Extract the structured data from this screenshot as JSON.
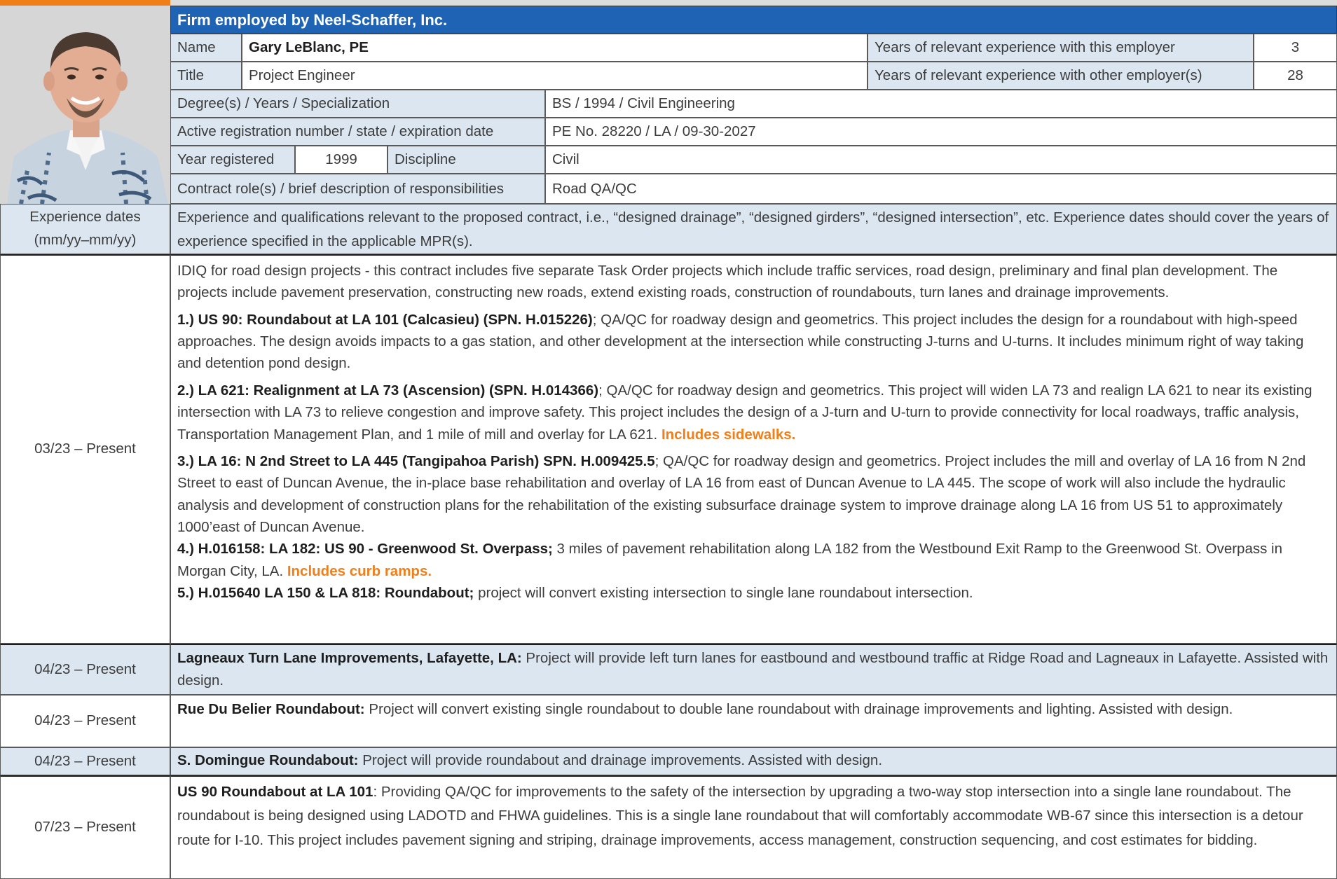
{
  "header": {
    "firm": "Firm employed by Neel-Schaffer, Inc."
  },
  "photo": {
    "alt": "Portrait photo"
  },
  "info": {
    "name_label": "Name",
    "name_value": "Gary LeBlanc, PE",
    "years_employer_label": "Years of relevant experience with this employer",
    "years_employer_value": "3",
    "title_label": "Title",
    "title_value": "Project Engineer",
    "years_other_label": "Years of relevant experience with other employer(s)",
    "years_other_value": "28",
    "degree_label": "Degree(s) / Years / Specialization",
    "degree_value": "BS / 1994 / Civil Engineering",
    "registration_label": "Active registration number / state / expiration date",
    "registration_value": "PE No. 28220 / LA / 09-30-2027",
    "year_registered_label": "Year registered",
    "year_registered_value": "1999",
    "discipline_label": "Discipline",
    "discipline_value": "Civil",
    "role_label": "Contract role(s) / brief description of responsibilities",
    "role_value": "Road QA/QC"
  },
  "experience_header": {
    "dates_label": "Experience dates (mm/yy–mm/yy)",
    "description": "Experience and qualifications relevant to the proposed contract, i.e., “designed drainage”, “designed girders”, “designed intersection”, etc. Experience dates should cover the years of experience specified in the applicable MPR(s)."
  },
  "entries": [
    {
      "dates": "03/23 – Present",
      "intro": "IDIQ for road design projects - this contract includes five separate Task Order projects which include traffic services, road design, preliminary and final plan development. The projects include pavement preservation, constructing new roads, extend existing roads, construction of roundabouts, turn lanes and drainage improvements.",
      "p1_bold": "1.) US 90: Roundabout at LA 101 (Calcasieu) (SPN. H.015226)",
      "p1_text": "; QA/QC for roadway design and geometrics. This project includes the design for a roundabout with high-speed approaches. The design avoids impacts to a gas station, and other development at the intersection while constructing J-turns and U-turns. It includes minimum right of way taking and detention pond design.",
      "p2_bold": "2.) LA 621: Realignment at LA 73 (Ascension) (SPN. H.014366)",
      "p2_text": "; QA/QC for roadway design and geometrics. This project will widen LA 73 and realign LA 621 to near its existing intersection with LA 73 to relieve congestion and improve safety. This project includes the design of a J-turn and U-turn to provide connectivity for local roadways, traffic analysis, Transportation Management Plan, and 1 mile of mill and overlay for LA 621. ",
      "p2_highlight": "Includes sidewalks.",
      "p3_bold": "3.) LA 16: N 2nd Street to LA 445 (Tangipahoa Parish) SPN. H.009425.5",
      "p3_text": "; QA/QC for roadway design and geometrics. Project includes the mill and overlay of LA 16 from N 2nd Street to east of Duncan Avenue, the in-place base rehabilitation and overlay of LA 16 from east of Duncan Avenue to LA 445. The scope of work will also include the hydraulic analysis and development of construction plans for the rehabilitation of the existing subsurface drainage system to improve drainage along LA 16 from US 51 to approximately 1000’east of Duncan Avenue.",
      "p4_bold": "4.) H.016158: LA 182: US 90 - Greenwood St. Overpass;",
      "p4_text": " 3 miles of pavement rehabilitation along LA 182 from the Westbound Exit Ramp to the Greenwood St. Overpass in Morgan City, LA. ",
      "p4_highlight": "Includes curb ramps.",
      "p5_bold": "5.) H.015640 LA 150 & LA 818: Roundabout;",
      "p5_text": " project will convert existing intersection to single lane roundabout intersection."
    },
    {
      "dates": "04/23 – Present",
      "bold": "Lagneaux Turn Lane Improvements, Lafayette, LA:",
      "text": " Project will provide left turn lanes for eastbound and westbound traffic at Ridge Road and Lagneaux in Lafayette. Assisted with design."
    },
    {
      "dates": "04/23 – Present",
      "bold": "Rue Du Belier Roundabout:",
      "text": " Project will convert existing single roundabout to double lane roundabout with drainage improvements and lighting. Assisted with design."
    },
    {
      "dates": "04/23 – Present",
      "bold": "S. Domingue Roundabout:",
      "text": " Project will provide roundabout and drainage improvements. Assisted with design."
    },
    {
      "dates": "07/23 – Present",
      "bold": "US 90 Roundabout at LA 101",
      "text": ": Providing QA/QC for improvements to the safety of the intersection by upgrading a two-way stop intersection into a single lane roundabout. The roundabout is being designed using LADOTD and FHWA guidelines. This is a single lane roundabout that will comfortably accommodate WB-67 since this intersection is a detour route for I-10. This project includes pavement signing and striping, drainage improvements, access management, construction sequencing, and cost estimates for bidding."
    }
  ],
  "colors": {
    "header_blue": "#1f63b4",
    "label_fill": "#dce6f1",
    "accent_orange": "#f07f1a"
  }
}
